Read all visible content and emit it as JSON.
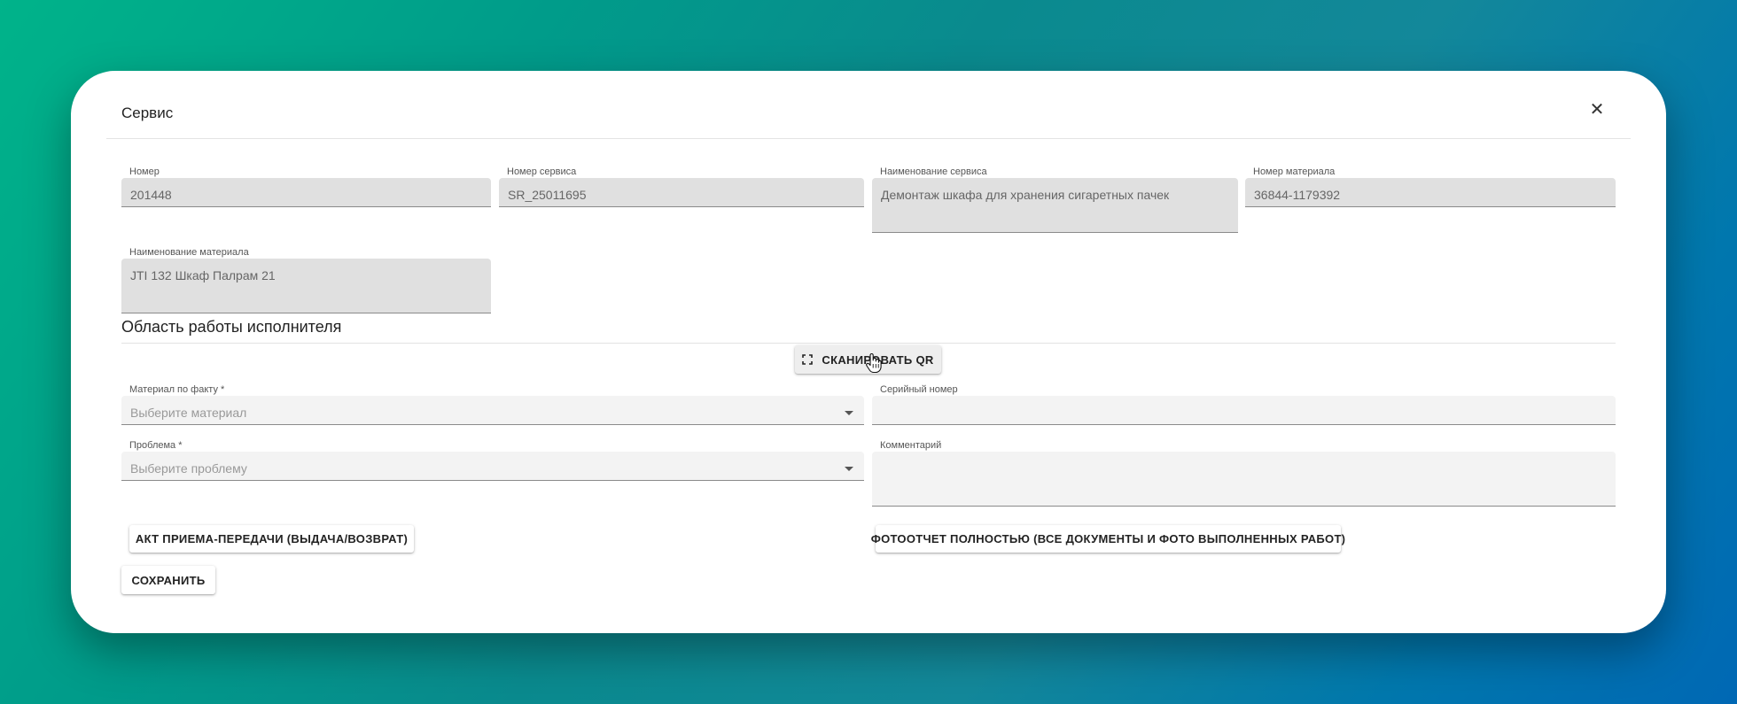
{
  "dialog": {
    "title": "Сервис",
    "close_glyph": "✕"
  },
  "fields": {
    "number": {
      "label": "Номер",
      "value": "201448"
    },
    "service_number": {
      "label": "Номер сервиса",
      "value": "SR_25011695"
    },
    "service_name": {
      "label": "Наименование сервиса",
      "value": "Демонтаж шкафа для хранения сигаретных пачек"
    },
    "material_number": {
      "label": "Номер материала",
      "value": "36844-1179392"
    },
    "material_name": {
      "label": "Наименование материала",
      "value": "JTI 132 Шкаф Палрам 21"
    }
  },
  "executor": {
    "section_title": "Область работы исполнителя",
    "scan_button": "Сканировать QR",
    "material_fact": {
      "label": "Материал по факту *",
      "placeholder": "Выберите материал"
    },
    "serial_number": {
      "label": "Серийный номер",
      "value": ""
    },
    "problem": {
      "label": "Проблема *",
      "placeholder": "Выберите проблему"
    },
    "comment": {
      "label": "Комментарий",
      "value": ""
    }
  },
  "actions": {
    "act_button": "Акт приема-передачи (выдача/возврат)",
    "photo_report_button": "Фотоотчет полностью (все документы и фото выполненных работ)",
    "save_button": "Сохранить"
  },
  "icons": {
    "close": "close-icon",
    "scan": "qr-scan-icon",
    "dropdown": "chevron-down-icon",
    "cursor": "hand-pointer-icon"
  }
}
